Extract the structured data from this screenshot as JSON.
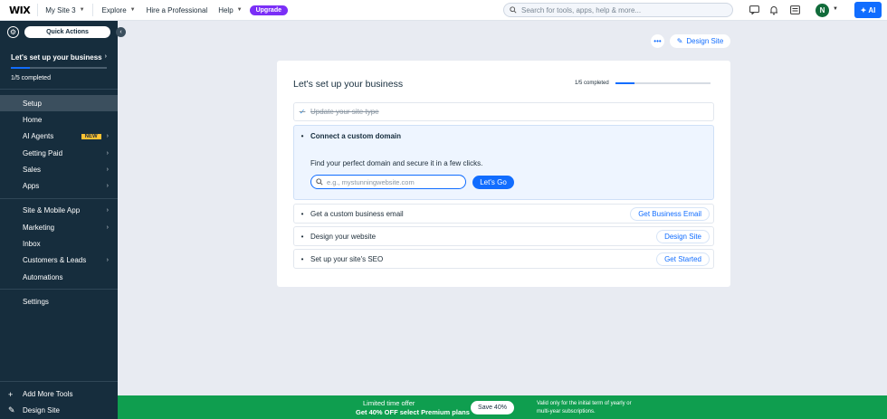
{
  "topbar": {
    "logo": "WIX",
    "site_name": "My Site 3",
    "explore": "Explore",
    "hire": "Hire a Professional",
    "help": "Help",
    "upgrade": "Upgrade",
    "search_placeholder": "Search for tools, apps, help & more...",
    "avatar_initial": "N",
    "ai_label": "AI"
  },
  "sidebar": {
    "quick_actions": "Quick Actions",
    "setup_title": "Let's set up your business",
    "setup_count": "1/5 completed",
    "setup_progress": 0.2,
    "items": [
      {
        "label": "Setup",
        "active": true,
        "chevron": false
      },
      {
        "label": "Home",
        "chevron": false
      },
      {
        "label": "AI Agents",
        "badge": "NEW",
        "chevron": true
      },
      {
        "label": "Getting Paid",
        "chevron": true
      },
      {
        "label": "Sales",
        "chevron": true
      },
      {
        "label": "Apps",
        "chevron": true
      },
      {
        "label": "Site & Mobile App",
        "chevron": true
      },
      {
        "label": "Marketing",
        "chevron": true
      },
      {
        "label": "Inbox",
        "chevron": false
      },
      {
        "label": "Customers & Leads",
        "chevron": true
      },
      {
        "label": "Automations",
        "chevron": false
      },
      {
        "label": "Settings",
        "chevron": false
      }
    ],
    "bottom": {
      "add_tools": "Add More Tools",
      "design_site": "Design Site"
    }
  },
  "main": {
    "design_site": "Design Site",
    "card": {
      "title": "Let's set up your business",
      "progress_text": "1/5 completed",
      "progress": 0.2,
      "tasks": {
        "site_type": "Update your site type",
        "domain": "Connect a custom domain",
        "domain_desc": "Find your perfect domain and secure it in a few clicks.",
        "domain_placeholder": "e.g., mystunningwebsite.com",
        "lets_go": "Let's Go",
        "email": "Get a custom business email",
        "email_btn": "Get Business Email",
        "design": "Design your website",
        "design_btn": "Design Site",
        "seo": "Set up your site's SEO",
        "seo_btn": "Get Started"
      }
    }
  },
  "promo": {
    "line1": "Limited time offer",
    "line2": "Get 40% OFF select Premium plans",
    "button": "Save 40%",
    "note1": "Valid only for the initial term of yearly or",
    "note2": "multi-year subscriptions."
  }
}
